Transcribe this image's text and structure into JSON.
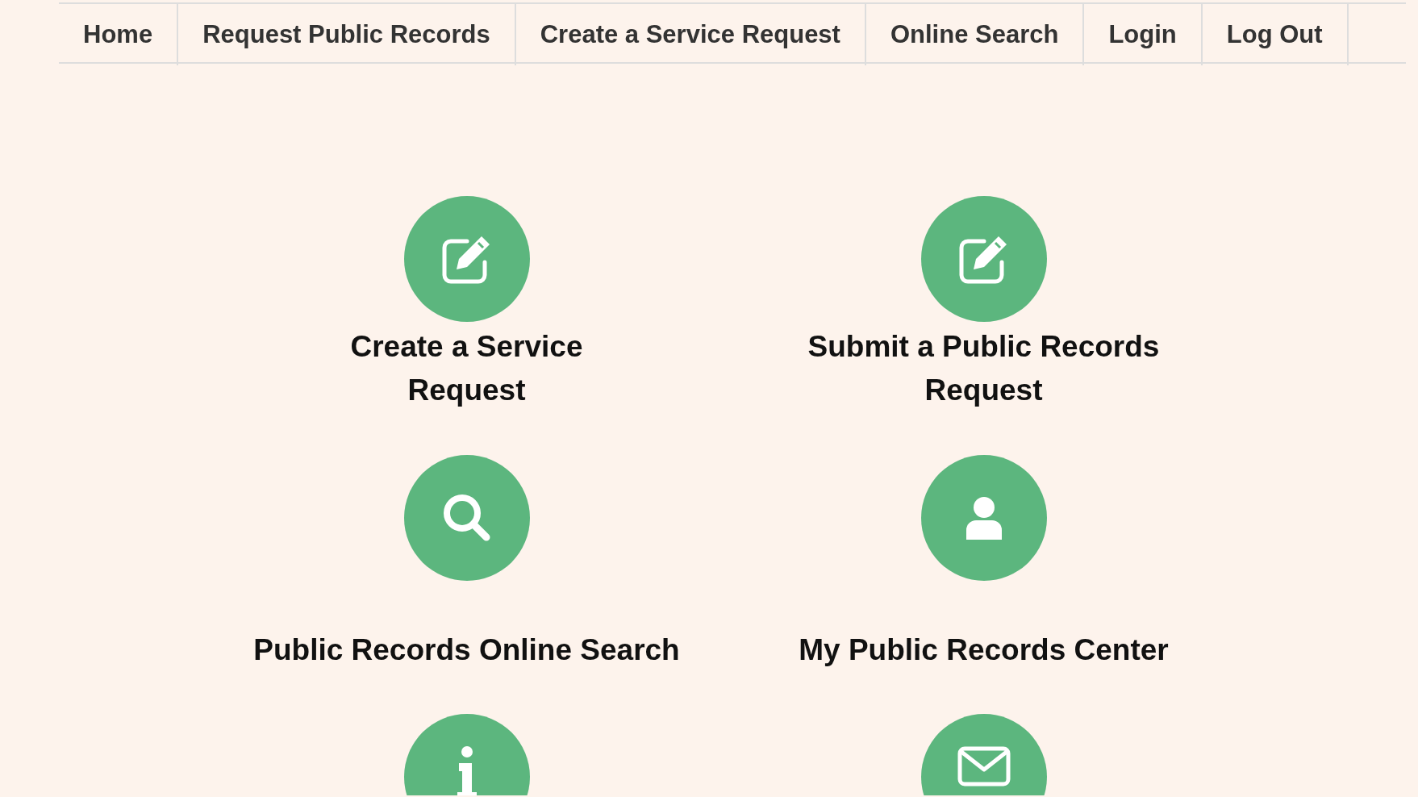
{
  "nav": [
    {
      "label": "Home"
    },
    {
      "label": "Request Public Records"
    },
    {
      "label": "Create a Service Request"
    },
    {
      "label": "Online Search"
    },
    {
      "label": "Login"
    },
    {
      "label": "Log Out"
    }
  ],
  "tiles": [
    {
      "kind": "titled",
      "title": "Create a Service Request"
    },
    {
      "kind": "titled",
      "title": "Submit a Public Records Request"
    },
    {
      "kind": "titled",
      "title": "Public Records Online Search"
    },
    {
      "kind": "titled",
      "title": "My Public Records Center"
    },
    {
      "kind": "icon-only"
    },
    {
      "kind": "icon-only"
    }
  ]
}
